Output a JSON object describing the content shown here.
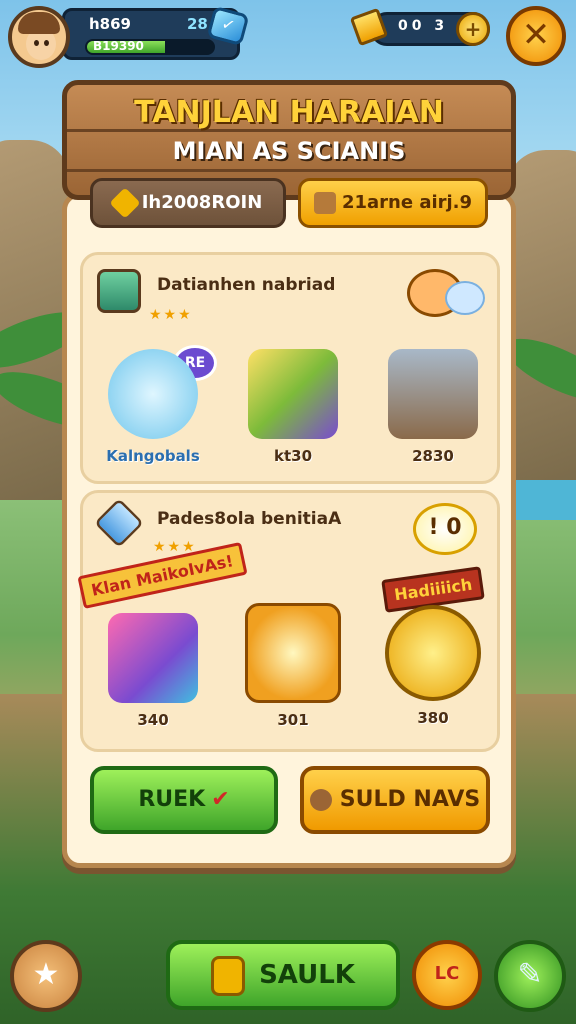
{
  "hud": {
    "level_text": "h869",
    "level_num": "28",
    "xp_text": "B19390",
    "xp_fill_fraction": 0.62,
    "coins_text": "00 3",
    "plus_label": "+",
    "close_label": "✕",
    "gem_glyph": "✓"
  },
  "header": {
    "title": "TANJLAN HARAIAN",
    "subtitle": "MIAN AS SCIANIS"
  },
  "tabs": [
    {
      "label": "Ih2008ROIN",
      "icon": "chevron-icon",
      "selected": false
    },
    {
      "label": "21arne airj.9",
      "icon": "paw-icon",
      "selected": true
    }
  ],
  "section1": {
    "title": "Datianhen nabriad",
    "stars": "★★★",
    "badge": "RE",
    "items": [
      {
        "name": "explorer-character",
        "price": "Kalngobals",
        "color": "#6fc6ec"
      },
      {
        "name": "crate-with-leaves",
        "price": "kt30",
        "color": "#7dbb3a"
      },
      {
        "name": "wheelbarrow-cart",
        "price": "2830",
        "color": "#8a6a4a"
      }
    ]
  },
  "section2": {
    "title": "Pades8ola benitiaA",
    "stars": "★★★",
    "banner_left": "Klan MaikoIvAs!",
    "banner_right": "Hadiiiich",
    "bubble_text": "! 0",
    "items": [
      {
        "name": "gem-backpack",
        "price": "340"
      },
      {
        "name": "fruit-chest",
        "price": "301"
      },
      {
        "name": "giant-gold-coin",
        "price": "380"
      }
    ]
  },
  "actions": {
    "green_label": "RUEK",
    "green_icon": "✔",
    "orange_label": "SULD NAVS"
  },
  "bottom": {
    "home_icon": "★",
    "main_label": "SAULK",
    "chat_label": "LC",
    "feather_icon": "✎"
  },
  "colors": {
    "accent_gold": "#ffd23a",
    "wood": "#9b6535",
    "green_btn": "#3fa52a",
    "orange_btn": "#f0a000"
  }
}
